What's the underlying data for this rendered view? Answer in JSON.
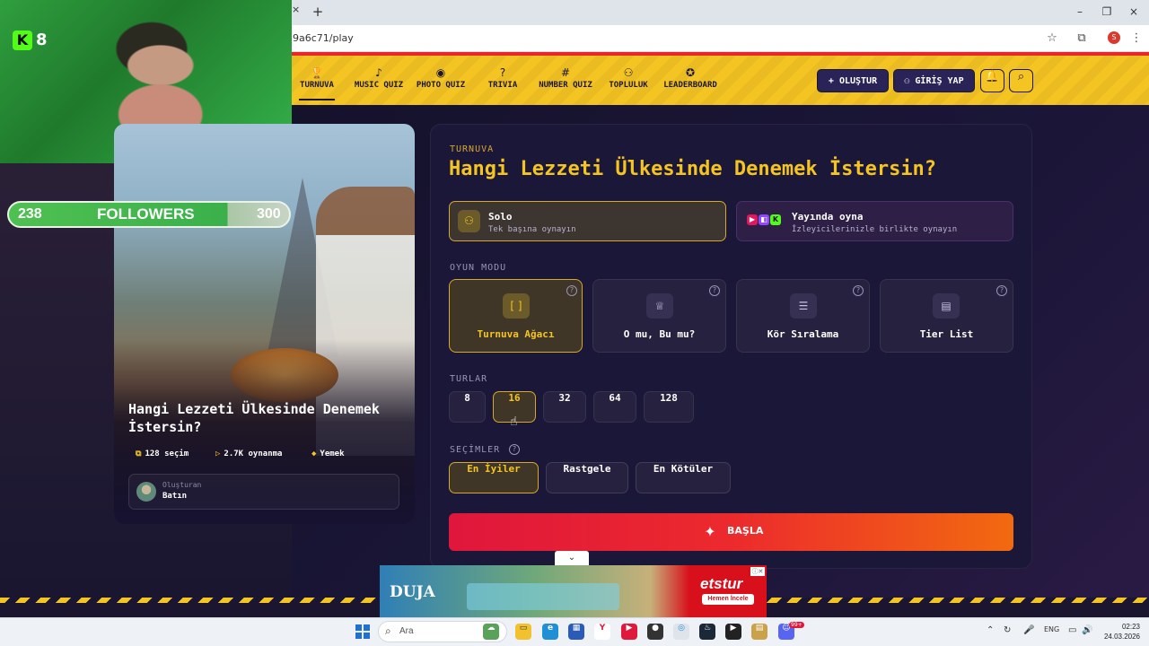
{
  "browser": {
    "url_fragment": "9a6c71/play",
    "tab_close": "×",
    "new_tab": "+",
    "window_controls": [
      "–",
      "❐",
      "×"
    ],
    "profile_letter": "S"
  },
  "stream_overlay": {
    "kick_count": "8",
    "followers": {
      "current": "238",
      "label": "FOLLOWERS",
      "goal": "300"
    }
  },
  "nav": {
    "items": [
      {
        "label": "TURNUVA",
        "icon": "trophy-icon",
        "glyph": "🏆"
      },
      {
        "label": "MUSIC QUIZ",
        "icon": "music-icon",
        "glyph": "♪"
      },
      {
        "label": "PHOTO QUIZ",
        "icon": "camera-icon",
        "glyph": "◉"
      },
      {
        "label": "TRIVIA",
        "icon": "question-icon",
        "glyph": "?"
      },
      {
        "label": "NUMBER QUIZ",
        "icon": "hash-icon",
        "glyph": "#"
      },
      {
        "label": "TOPLULUK",
        "icon": "users-icon",
        "glyph": "⚇"
      },
      {
        "label": "LEADERBOARD",
        "icon": "medal-icon",
        "glyph": "✪"
      }
    ],
    "create_label": "+ OLUŞTUR",
    "login_label": "⚇ GİRİŞ YAP",
    "bell_glyph": "🔔",
    "search_glyph": "⌕"
  },
  "quiz_card": {
    "title": "Hangi Lezzeti Ülkesinde Denemek İstersin?",
    "choices": "128 seçim",
    "plays": "2.7K oynanma",
    "category": "Yemek",
    "creator_label": "Oluşturan",
    "creator_name": "Batın"
  },
  "panel": {
    "kicker": "TURNUVA",
    "title": "Hangi Lezzeti Ülkesinde Denemek İstersin?",
    "play_modes": [
      {
        "name": "Solo",
        "subtitle": "Tek başına oynayın",
        "selected": true
      },
      {
        "name": "Yayında oyna",
        "subtitle": "İzleyicilerinizle birlikte oynayın",
        "selected": false
      }
    ],
    "game_mode_label": "OYUN MODU",
    "game_modes": [
      {
        "label": "Turnuva Ağacı",
        "icon": "bracket-icon",
        "glyph": "[ ]",
        "selected": true
      },
      {
        "label": "O mu, Bu mu?",
        "icon": "crown-icon",
        "glyph": "♕",
        "selected": false
      },
      {
        "label": "Kör Sıralama",
        "icon": "list-ordered-icon",
        "glyph": "☰",
        "selected": false
      },
      {
        "label": "Tier List",
        "icon": "tier-list-icon",
        "glyph": "▤",
        "selected": false
      }
    ],
    "rounds_label": "TURLAR",
    "rounds": [
      "8",
      "16",
      "32",
      "64",
      "128"
    ],
    "rounds_selected": "16",
    "selection_label": "SEÇİMLER",
    "selection_options": [
      "En İyiler",
      "Rastgele",
      "En Kötüler"
    ],
    "selection_selected": "En İyiler",
    "start_label": "BAŞLA"
  },
  "ad": {
    "left_logo": "DUJA",
    "brand": "etstur",
    "cta": "Hemen İncele",
    "toggle_glyph": "⌄"
  },
  "taskbar": {
    "search_placeholder": "Ara",
    "language": "ENG",
    "time": "02:23",
    "date": "24.03.2026",
    "discord_badge": "99+"
  }
}
